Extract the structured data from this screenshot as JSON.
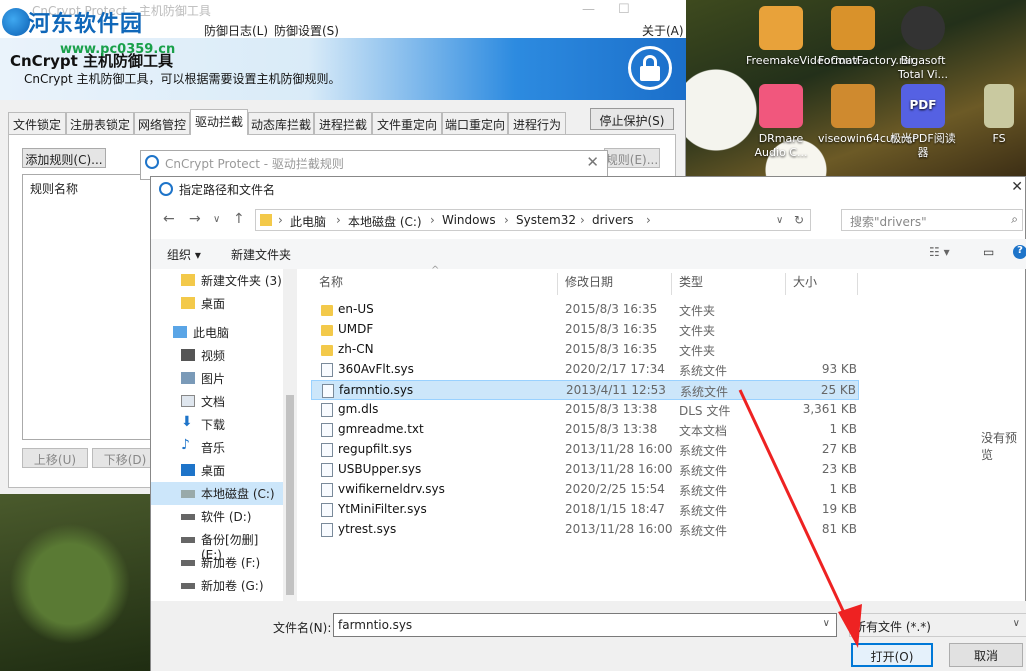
{
  "main_window": {
    "title": "CnCrypt Protect - 主机防御工具",
    "menu": [
      "防御日志(L)",
      "防御设置(S)"
    ],
    "about": "关于(A)",
    "app_name": "CnCrypt 主机防御工具",
    "app_subtitle": "CnCrypt 主机防御工具，可以根据需要设置主机防御规则。",
    "tabs": [
      "文件锁定",
      "注册表锁定",
      "网络管控",
      "驱动拦截",
      "动态库拦截",
      "进程拦截",
      "文件重定向",
      "端口重定向",
      "进程行为"
    ],
    "active_tab": "驱动拦截",
    "stop_button": "停止保护(S)",
    "add_rule_button": "添加规则(C)...",
    "rule_header": "规则名称",
    "up_button": "上移(U)",
    "down_button": "下移(D)",
    "other_button": "规则(E)..."
  },
  "watermark": {
    "site_name": "河东软件园",
    "url": "www.pc0359.cn"
  },
  "desktop_icons": [
    {
      "label": "FreemakeVideoConv...",
      "color": "#e8a23a"
    },
    {
      "label": "FormatFactory.rar",
      "color": "#d9922b"
    },
    {
      "label": "Bigasoft Total Vi...",
      "color": "#333333"
    },
    {
      "label": "DRmare Audio C...",
      "color": "#f1577d"
    },
    {
      "label": "viseowin64cut.rar",
      "color": "#cf8a2f"
    },
    {
      "label": "极光PDF阅读器",
      "color": "#5561e3"
    },
    {
      "label": "FS",
      "color": "#c9c9a0"
    }
  ],
  "bg_dialog": {
    "title": "CnCrypt Protect - 驱动拦截规则"
  },
  "file_dialog": {
    "title": "指定路径和文件名",
    "breadcrumb": [
      "此电脑",
      "本地磁盘 (C:)",
      "Windows",
      "System32",
      "drivers"
    ],
    "search_placeholder": "搜索\"drivers\"",
    "organize": "组织 ▾",
    "new_folder": "新建文件夹",
    "nav_items": [
      {
        "label": "新建文件夹 (3)",
        "icon": "folder-icon"
      },
      {
        "label": "桌面",
        "icon": "folder-icon"
      },
      {
        "label": "此电脑",
        "icon": "computer-icon"
      },
      {
        "label": "视频",
        "icon": "video-icon"
      },
      {
        "label": "图片",
        "icon": "picture-icon"
      },
      {
        "label": "文档",
        "icon": "document-icon"
      },
      {
        "label": "下载",
        "icon": "download-icon"
      },
      {
        "label": "音乐",
        "icon": "music-icon"
      },
      {
        "label": "桌面",
        "icon": "desktop-icon"
      },
      {
        "label": "本地磁盘 (C:)",
        "icon": "drive-icon"
      },
      {
        "label": "软件 (D:)",
        "icon": "drive-icon"
      },
      {
        "label": "备份[勿删] (E:)",
        "icon": "drive-icon"
      },
      {
        "label": "新加卷 (F:)",
        "icon": "drive-icon"
      },
      {
        "label": "新加卷 (G:)",
        "icon": "drive-icon"
      }
    ],
    "selected_nav": "本地磁盘 (C:)",
    "columns": [
      "名称",
      "修改日期",
      "类型",
      "大小"
    ],
    "files": [
      {
        "name": "en-US",
        "date": "2015/8/3 16:35",
        "type": "文件夹",
        "size": "",
        "kind": "folder"
      },
      {
        "name": "UMDF",
        "date": "2015/8/3 16:35",
        "type": "文件夹",
        "size": "",
        "kind": "folder"
      },
      {
        "name": "zh-CN",
        "date": "2015/8/3 16:35",
        "type": "文件夹",
        "size": "",
        "kind": "folder"
      },
      {
        "name": "360AvFlt.sys",
        "date": "2020/2/17 17:34",
        "type": "系统文件",
        "size": "93 KB",
        "kind": "file"
      },
      {
        "name": "farmntio.sys",
        "date": "2013/4/11 12:53",
        "type": "系统文件",
        "size": "25 KB",
        "kind": "file"
      },
      {
        "name": "gm.dls",
        "date": "2015/8/3 13:38",
        "type": "DLS 文件",
        "size": "3,361 KB",
        "kind": "file"
      },
      {
        "name": "gmreadme.txt",
        "date": "2015/8/3 13:38",
        "type": "文本文档",
        "size": "1 KB",
        "kind": "file"
      },
      {
        "name": "regupfilt.sys",
        "date": "2013/11/28 16:00",
        "type": "系统文件",
        "size": "27 KB",
        "kind": "file"
      },
      {
        "name": "USBUpper.sys",
        "date": "2013/11/28 16:00",
        "type": "系统文件",
        "size": "23 KB",
        "kind": "file"
      },
      {
        "name": "vwifikerneldrv.sys",
        "date": "2020/2/25 15:54",
        "type": "系统文件",
        "size": "1 KB",
        "kind": "file"
      },
      {
        "name": "YtMiniFilter.sys",
        "date": "2018/1/15 18:47",
        "type": "系统文件",
        "size": "19 KB",
        "kind": "file"
      },
      {
        "name": "ytrest.sys",
        "date": "2013/11/28 16:00",
        "type": "系统文件",
        "size": "81 KB",
        "kind": "file"
      }
    ],
    "selected_file": "farmntio.sys",
    "preview_text": "没有预览",
    "filename_label": "文件名(N):",
    "filename_value": "farmntio.sys",
    "filetype_value": "所有文件 (*.*)",
    "open_button": "打开(O)",
    "cancel_button": "取消"
  },
  "colors": {
    "selection": "#cce6fa",
    "accent": "#0078d7",
    "arrow": "#ee2222"
  }
}
